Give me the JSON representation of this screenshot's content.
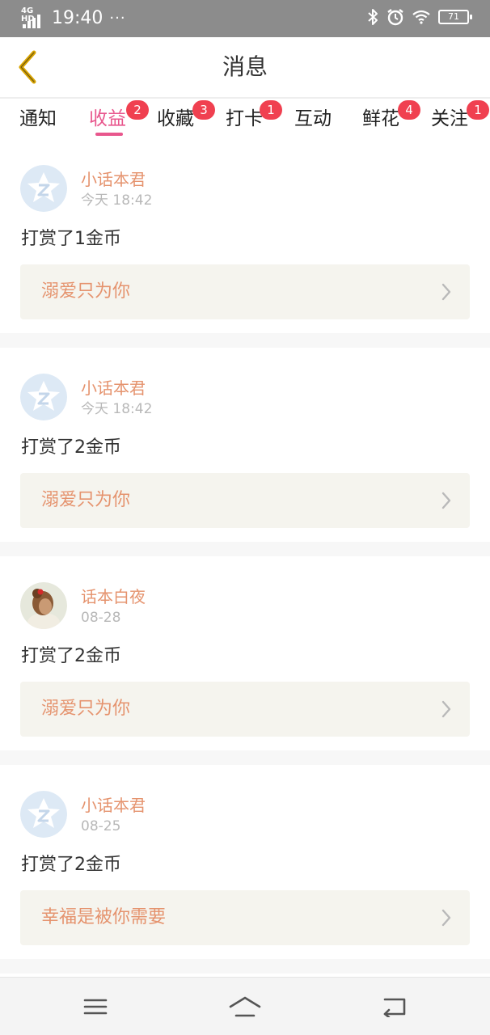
{
  "status_bar": {
    "network": "4G HD",
    "time": "19:40",
    "more": "···",
    "battery": "71",
    "icons": [
      "bluetooth-icon",
      "alarm-icon",
      "wifi-icon",
      "battery-icon"
    ]
  },
  "header": {
    "title": "消息",
    "back_icon": "chevron-left-icon"
  },
  "colors": {
    "accent": "#e8578d",
    "name_color": "#e5936e",
    "badge": "#f04050",
    "back_icon": "#d9a400",
    "work_box_bg": "#f5f4ee"
  },
  "tabs": [
    {
      "label": "通知",
      "badge": null,
      "active": false
    },
    {
      "label": "收益",
      "badge": "2",
      "active": true
    },
    {
      "label": "收藏",
      "badge": "3",
      "active": false
    },
    {
      "label": "打卡",
      "badge": "1",
      "active": false
    },
    {
      "label": "互动",
      "badge": null,
      "active": false
    },
    {
      "label": "鲜花",
      "badge": "4",
      "active": false
    },
    {
      "label": "关注",
      "badge": "1",
      "active": false
    }
  ],
  "feed": [
    {
      "avatar": "default-star-avatar",
      "name": "小话本君",
      "time": "今天 18:42",
      "message": "打赏了1金币",
      "work": "溺爱只为你"
    },
    {
      "avatar": "default-star-avatar",
      "name": "小话本君",
      "time": "今天 18:42",
      "message": "打赏了2金币",
      "work": "溺爱只为你"
    },
    {
      "avatar": "photo-avatar",
      "name": "话本白夜",
      "time": "08-28",
      "message": "打赏了2金币",
      "work": "溺爱只为你"
    },
    {
      "avatar": "default-star-avatar",
      "name": "小话本君",
      "time": "08-25",
      "message": "打赏了2金币",
      "work": "幸福是被你需要"
    }
  ],
  "bottom_nav": {
    "icons": [
      "menu-icon",
      "home-icon",
      "back-icon"
    ]
  }
}
